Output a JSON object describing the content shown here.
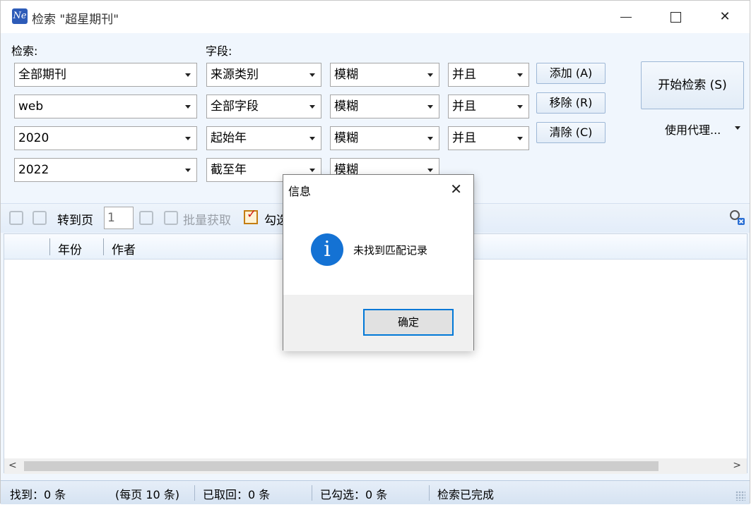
{
  "window": {
    "app_icon": "Ne",
    "title": "检索 \"超星期刊\"",
    "minimize": "minimize-icon",
    "maximize": "maximize-icon",
    "close": "✕"
  },
  "labels": {
    "search": "检索:",
    "field": "字段:"
  },
  "rows": [
    {
      "scope": "全部期刊",
      "field": "来源类别",
      "match": "模糊",
      "logic": "并且"
    },
    {
      "scope": "web",
      "field": "全部字段",
      "match": "模糊",
      "logic": "并且"
    },
    {
      "scope": "2020",
      "field": "起始年",
      "match": "模糊",
      "logic": "并且"
    },
    {
      "scope": "2022",
      "field": "截至年",
      "match": "模糊"
    }
  ],
  "buttons": {
    "add": "添加 (A)",
    "remove": "移除 (R)",
    "clear": "清除 (C)",
    "start": "开始检索 (S)",
    "proxy": "使用代理..."
  },
  "toolbar": {
    "goto_label": "转到页",
    "page_value": "1",
    "batch_label": "批量获取",
    "check_label": "勾选"
  },
  "grid": {
    "columns": [
      "年份",
      "作者"
    ]
  },
  "status": {
    "found": "找到：0 条",
    "per_page": "(每页 10 条)",
    "retrieved": "已取回：0 条",
    "checked": "已勾选：0 条",
    "state": "检索已完成"
  },
  "dialog": {
    "title": "信息",
    "message": "未找到匹配记录",
    "ok": "确定",
    "icon": "info-icon"
  },
  "colors": {
    "accent": "#0078d7",
    "info": "#1472d4",
    "panel": "#f0f6fd"
  }
}
